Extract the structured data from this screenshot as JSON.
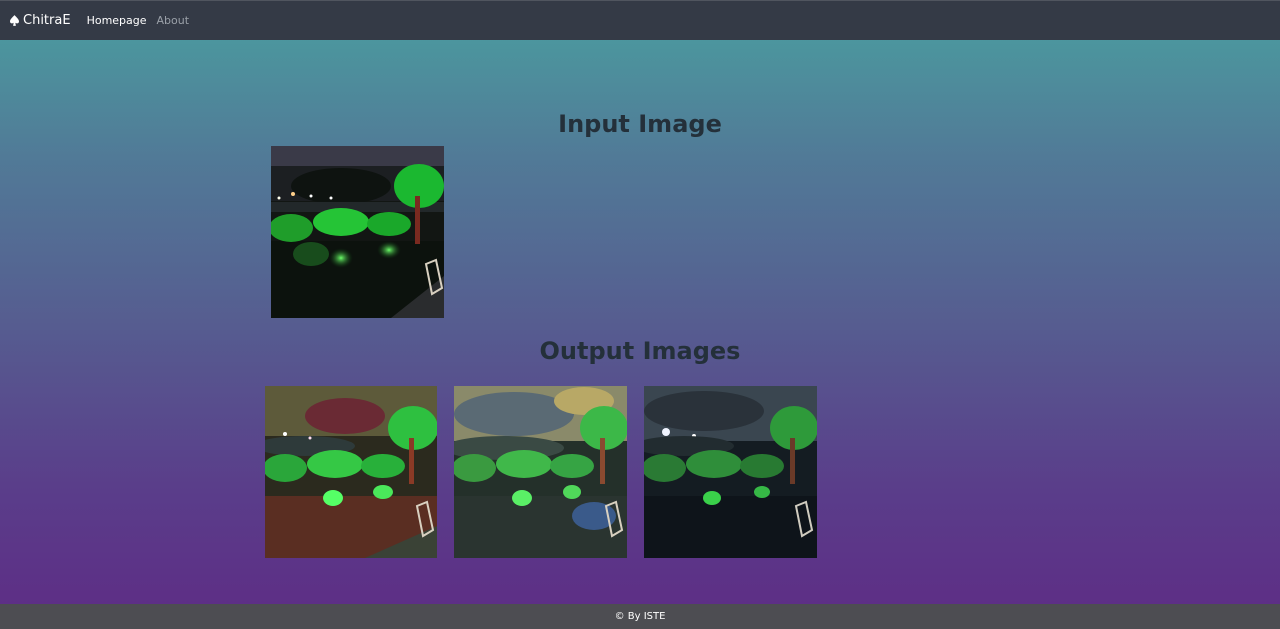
{
  "navbar": {
    "brand": "ChitraE",
    "brand_icon": "spade-icon",
    "links": [
      {
        "label": "Homepage",
        "active": true
      },
      {
        "label": "About",
        "active": false
      }
    ]
  },
  "sections": {
    "input_title": "Input Image",
    "output_title": "Output Images"
  },
  "footer": {
    "text": "© By ISTE"
  },
  "colors": {
    "navbar_bg": "#343a46",
    "footer_bg": "#4d4d52",
    "gradient_top": "#4a9fa0",
    "gradient_bottom": "#5e2c85",
    "title_color": "#24303a"
  }
}
